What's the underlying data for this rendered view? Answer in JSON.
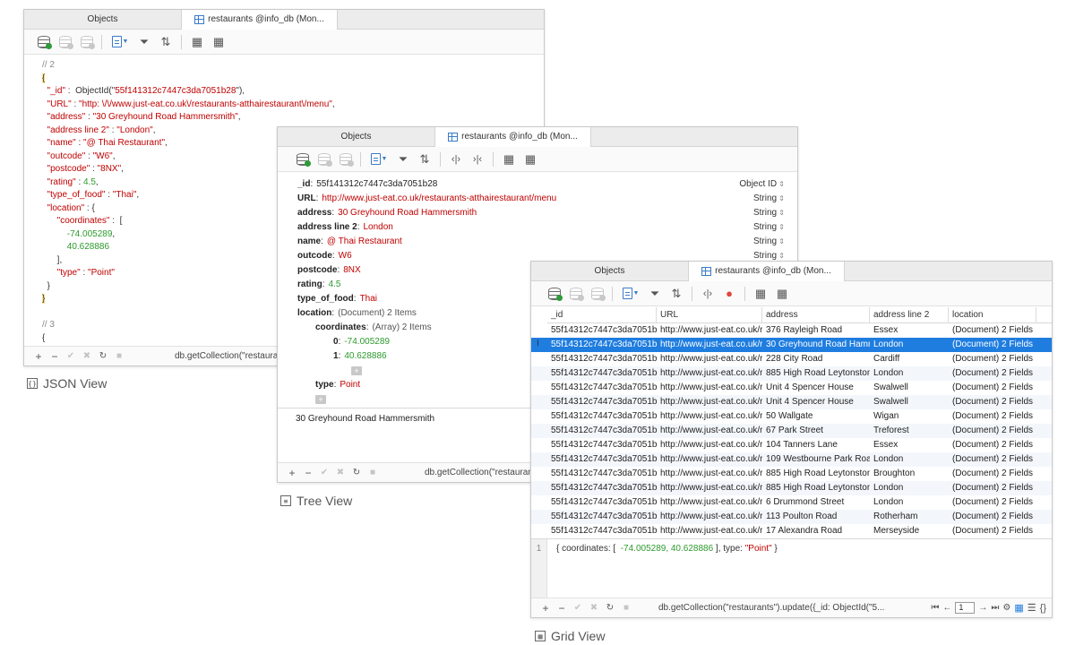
{
  "json_window": {
    "tabs": [
      "Objects",
      "restaurants @info_db (Mon..."
    ],
    "lines": [
      [
        {
          "t": "c",
          "v": "// 2"
        }
      ],
      [
        {
          "t": "h",
          "v": "{"
        }
      ],
      [
        {
          "t": "k",
          "v": "  \"_id\""
        },
        {
          "t": "p",
          "v": " :  ObjectId(\""
        },
        {
          "t": "s",
          "v": "55f141312c7447c3da7051b28"
        },
        {
          "t": "p",
          "v": "\"),"
        }
      ],
      [
        {
          "t": "k",
          "v": "  \"URL\""
        },
        {
          "t": "p",
          "v": " : "
        },
        {
          "t": "s",
          "v": "\"http: \\/\\/www.just-eat.co.uk\\/restaurants-atthairestaurant\\/menu\""
        },
        {
          "t": "p",
          "v": ","
        }
      ],
      [
        {
          "t": "k",
          "v": "  \"address\""
        },
        {
          "t": "p",
          "v": " : "
        },
        {
          "t": "s",
          "v": "\"30 Greyhound Road Hammersmith\""
        },
        {
          "t": "p",
          "v": ","
        }
      ],
      [
        {
          "t": "k",
          "v": "  \"address line 2\""
        },
        {
          "t": "p",
          "v": " : "
        },
        {
          "t": "s",
          "v": "\"London\""
        },
        {
          "t": "p",
          "v": ","
        }
      ],
      [
        {
          "t": "k",
          "v": "  \"name\""
        },
        {
          "t": "p",
          "v": " : "
        },
        {
          "t": "s",
          "v": "\"@ Thai Restaurant\""
        },
        {
          "t": "p",
          "v": ","
        }
      ],
      [
        {
          "t": "k",
          "v": "  \"outcode\""
        },
        {
          "t": "p",
          "v": " : "
        },
        {
          "t": "s",
          "v": "\"W6\""
        },
        {
          "t": "p",
          "v": ","
        }
      ],
      [
        {
          "t": "k",
          "v": "  \"postcode\""
        },
        {
          "t": "p",
          "v": " : "
        },
        {
          "t": "s",
          "v": "\"8NX\""
        },
        {
          "t": "p",
          "v": ","
        }
      ],
      [
        {
          "t": "k",
          "v": "  \"rating\""
        },
        {
          "t": "p",
          "v": " : "
        },
        {
          "t": "n",
          "v": "4.5"
        },
        {
          "t": "p",
          "v": ","
        }
      ],
      [
        {
          "t": "k",
          "v": "  \"type_of_food\""
        },
        {
          "t": "p",
          "v": " : "
        },
        {
          "t": "s",
          "v": "\"Thai\""
        },
        {
          "t": "p",
          "v": ","
        }
      ],
      [
        {
          "t": "k",
          "v": "  \"location\""
        },
        {
          "t": "p",
          "v": " : {"
        }
      ],
      [
        {
          "t": "k",
          "v": "      \"coordinates\""
        },
        {
          "t": "p",
          "v": " :  ["
        }
      ],
      [
        {
          "t": "n",
          "v": "          -74.005289"
        },
        {
          "t": "p",
          "v": ","
        }
      ],
      [
        {
          "t": "n",
          "v": "          40.628886"
        }
      ],
      [
        {
          "t": "p",
          "v": "      ],"
        }
      ],
      [
        {
          "t": "k",
          "v": "      \"type\""
        },
        {
          "t": "p",
          "v": " : "
        },
        {
          "t": "s",
          "v": "\"Point\""
        }
      ],
      [
        {
          "t": "p",
          "v": "  }"
        }
      ],
      [
        {
          "t": "h",
          "v": "}"
        }
      ],
      [
        {
          "t": "p",
          "v": ""
        }
      ],
      [
        {
          "t": "c",
          "v": "// 3"
        }
      ],
      [
        {
          "t": "p",
          "v": "{"
        }
      ]
    ],
    "footer_query": "db.getCollection(\"restaurants\").update({_id: ObjectId(\"55f14...",
    "view_label": "JSON View"
  },
  "tree_window": {
    "tabs": [
      "Objects",
      "restaurants @info_db (Mon..."
    ],
    "rows": [
      {
        "indent": 0,
        "key": "_id",
        "value": "55f141312c7447c3da7051b28",
        "vtype": "id",
        "type": "Object ID"
      },
      {
        "indent": 0,
        "key": "URL",
        "value": "http://www.just-eat.co.uk/restaurants-atthairestaurant/menu",
        "vtype": "s",
        "type": "String"
      },
      {
        "indent": 0,
        "key": "address",
        "value": "30 Greyhound Road Hammersmith",
        "vtype": "s",
        "type": "String"
      },
      {
        "indent": 0,
        "key": "address line 2",
        "value": "London",
        "vtype": "s",
        "type": "String"
      },
      {
        "indent": 0,
        "key": "name",
        "value": "@ Thai Restaurant",
        "vtype": "s",
        "type": "String"
      },
      {
        "indent": 0,
        "key": "outcode",
        "value": "W6",
        "vtype": "s",
        "type": "String"
      },
      {
        "indent": 0,
        "key": "postcode",
        "value": "8NX",
        "vtype": "s",
        "type": "String"
      },
      {
        "indent": 0,
        "key": "rating",
        "value": "4.5",
        "vtype": "n",
        "type": ""
      },
      {
        "indent": 0,
        "key": "type_of_food",
        "value": "Thai",
        "vtype": "s",
        "type": ""
      },
      {
        "indent": 0,
        "key": "location",
        "value": "(Document) 2 Items",
        "vtype": "p",
        "type": ""
      },
      {
        "indent": 1,
        "key": "coordinates",
        "value": "(Array) 2 Items",
        "vtype": "p",
        "type": ""
      },
      {
        "indent": 2,
        "key": "0",
        "value": "-74.005289",
        "vtype": "n",
        "type": ""
      },
      {
        "indent": 2,
        "key": "1",
        "value": "40.628886",
        "vtype": "n",
        "type": ""
      },
      {
        "indent": 3,
        "key": "",
        "value": "",
        "vtype": "plus",
        "type": ""
      },
      {
        "indent": 1,
        "key": "type",
        "value": "Point",
        "vtype": "s",
        "type": ""
      },
      {
        "indent": 1,
        "key": "",
        "value": "",
        "vtype": "plus",
        "type": ""
      }
    ],
    "preview": "30 Greyhound Road Hammersmith",
    "footer_query": "db.getCollection(\"restaurants\").update({_id: ObjectId(\"55f14...",
    "view_label": "Tree View"
  },
  "grid_window": {
    "tabs": [
      "Objects",
      "restaurants @info_db (Mon..."
    ],
    "columns": [
      "_id",
      "URL",
      "address",
      "address line 2",
      "location"
    ],
    "rows": [
      [
        "55f14312c7447c3da7051b27",
        "http://www.just-eat.co.uk/r",
        "376 Rayleigh Road",
        "Essex",
        "(Document) 2 Fields"
      ],
      [
        "55f14312c7447c3da7051b28",
        "http://www.just-eat.co.uk/r",
        "30 Greyhound Road Hamm",
        "London",
        "(Document) 2 Fields"
      ],
      [
        "55f14312c7447c3da7051b26",
        "http://www.just-eat.co.uk/r",
        "228 City Road",
        "Cardiff",
        "(Document) 2 Fields"
      ],
      [
        "55f14312c7447c3da7051b29",
        "http://www.just-eat.co.uk/r",
        "885 High Road Leytonstone",
        "London",
        "(Document) 2 Fields"
      ],
      [
        "55f14312c7447c3da7051b2f",
        "http://www.just-eat.co.uk/r",
        "Unit 4 Spencer House",
        "Swalwell",
        "(Document) 2 Fields"
      ],
      [
        "55f14312c7447c3da7051b30",
        "http://www.just-eat.co.uk/r",
        "Unit 4 Spencer House",
        "Swalwell",
        "(Document) 2 Fields"
      ],
      [
        "55f14312c7447c3da7051b32",
        "http://www.just-eat.co.uk/r",
        "50 Wallgate",
        "Wigan",
        "(Document) 2 Fields"
      ],
      [
        "55f14312c7447c3da7051b31",
        "http://www.just-eat.co.uk/r",
        "67 Park Street",
        "Treforest",
        "(Document) 2 Fields"
      ],
      [
        "55f14312c7447c3da7051b33",
        "http://www.just-eat.co.uk/r",
        "104 Tanners Lane",
        "Essex",
        "(Document) 2 Fields"
      ],
      [
        "55f14312c7447c3da7051b34",
        "http://www.just-eat.co.uk/r",
        "109 Westbourne Park Road",
        "London",
        "(Document) 2 Fields"
      ],
      [
        "55f14312c7447c3da7051b2a",
        "http://www.just-eat.co.uk/r",
        "885 High Road Leytonstone",
        "Broughton",
        "(Document) 2 Fields"
      ],
      [
        "55f14312c7447c3da7051b2c",
        "http://www.just-eat.co.uk/r",
        "885 High Road Leytonstone",
        "London",
        "(Document) 2 Fields"
      ],
      [
        "55f14312c7447c3da7051b2d",
        "http://www.just-eat.co.uk/r",
        "6 Drummond Street",
        "London",
        "(Document) 2 Fields"
      ],
      [
        "55f14312c7447c3da7051b2b",
        "http://www.just-eat.co.uk/r",
        "113 Poulton Road",
        "Rotherham",
        "(Document) 2 Fields"
      ],
      [
        "55f14312c7447c3da7051b35",
        "http://www.just-eat.co.uk/r",
        "17 Alexandra Road",
        "Merseyside",
        "(Document) 2 Fields"
      ]
    ],
    "selected_row": 1,
    "preview_line_number": "1",
    "preview": [
      {
        "t": "p",
        "v": "{ coordinates: [ "
      },
      {
        "t": "n",
        "v": " -74.005289, 40.628886"
      },
      {
        "t": "p",
        "v": " ], type: "
      },
      {
        "t": "s",
        "v": "\"Point\""
      },
      {
        "t": "p",
        "v": " }"
      }
    ],
    "footer_query": "db.getCollection(\"restaurants\").update({_id: ObjectId(\"5...",
    "page_value": "1",
    "view_label": "Grid View"
  },
  "colors": {
    "accent": "#1f7de0",
    "string": "#c00000",
    "number": "#2d9a2d"
  }
}
